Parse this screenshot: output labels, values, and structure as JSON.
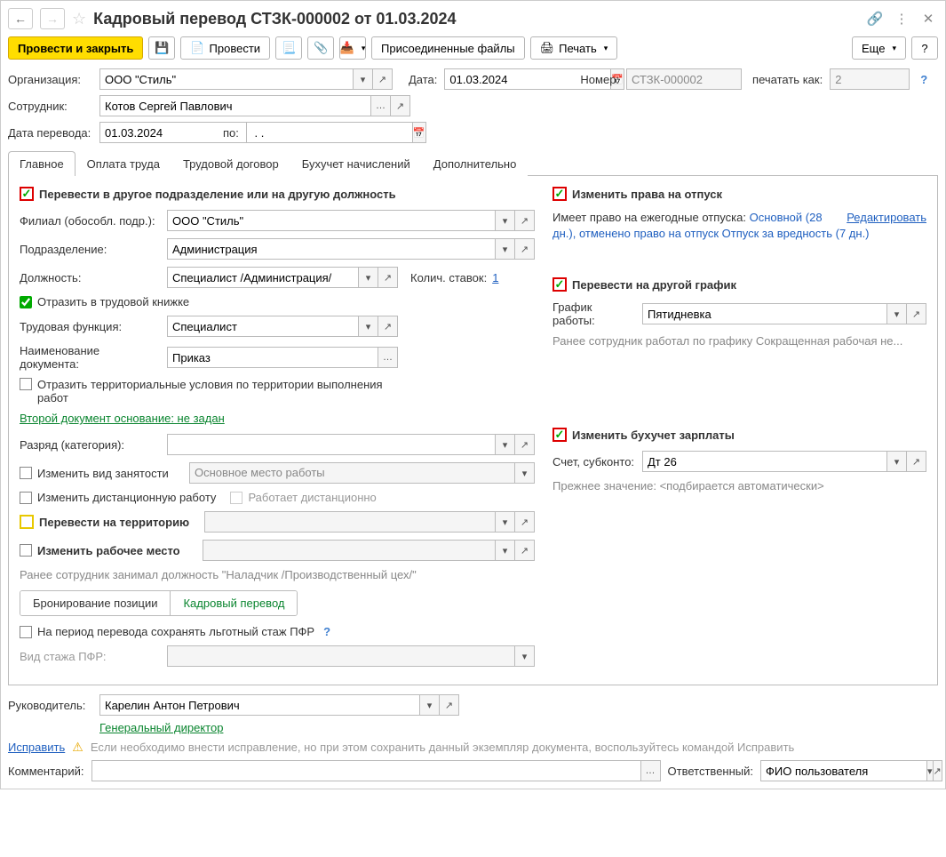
{
  "title": "Кадровый перевод СТЗК-000002 от 01.03.2024",
  "toolbar": {
    "post_close": "Провести и закрыть",
    "post": "Провести",
    "attached": "Присоединенные файлы",
    "print": "Печать",
    "more": "Еще"
  },
  "header": {
    "org_label": "Организация:",
    "org_value": "ООО \"Стиль\"",
    "date_label": "Дата:",
    "date_value": "01.03.2024",
    "number_label": "Номер:",
    "number_value": "СТЗК-000002",
    "print_as_label": "печатать как:",
    "print_as_value": "2",
    "employee_label": "Сотрудник:",
    "employee_value": "Котов Сергей Павлович",
    "transfer_date_label": "Дата перевода:",
    "transfer_date_value": "01.03.2024",
    "po_label": "по:",
    "po_value": " . ."
  },
  "tabs": {
    "main": "Главное",
    "salary": "Оплата труда",
    "contract": "Трудовой договор",
    "accounting": "Бухучет начислений",
    "additional": "Дополнительно"
  },
  "main_tab": {
    "transfer_dept": "Перевести в другое подразделение или на другую должность",
    "branch_label": "Филиал (обособл. подр.):",
    "branch_value": "ООО \"Стиль\"",
    "dept_label": "Подразделение:",
    "dept_value": "Администрация",
    "position_label": "Должность:",
    "position_value": "Специалист /Администрация/",
    "rates_label": "Колич. ставок:",
    "rates_value": "1",
    "workbook": "Отразить в трудовой книжке",
    "func_label": "Трудовая функция:",
    "func_value": "Специалист",
    "docname_label": "Наименование документа:",
    "docname_value": "Приказ",
    "territorial": "Отразить территориальные условия по территории выполнения работ",
    "second_doc": "Второй документ основание: не задан",
    "grade_label": "Разряд (категория):",
    "change_emp_type": "Изменить вид занятости",
    "emp_type_value": "Основное место работы",
    "change_remote": "Изменить дистанционную работу",
    "works_remote": "Работает дистанционно",
    "transfer_territory": "Перевести на территорию",
    "change_workplace": "Изменить рабочее место",
    "prev_position": "Ранее сотрудник занимал должность \"Наладчик /Производственный цех/\"",
    "booking": "Бронирование позиции",
    "transfer": "Кадровый перевод",
    "pfr": "На период перевода сохранять льготный стаж ПФР",
    "pfr_type_label": "Вид стажа ПФР:",
    "vacation_change": "Изменить права на отпуск",
    "vacation_text1": "Имеет право на ежегодные отпуска: ",
    "vacation_text2": "Основной (28 дн.)",
    "vacation_text3": ", отменено право на отпуск Отпуск за вредность (7 дн.)",
    "edit_link": "Редактировать",
    "schedule_change": "Перевести на другой график",
    "schedule_label": "График работы:",
    "schedule_value": "Пятидневка",
    "prev_schedule": "Ранее сотрудник работал по графику Сокращенная рабочая не...",
    "acc_change": "Изменить бухучет зарплаты",
    "acc_label": "Счет, субконто:",
    "acc_value": "Дт 26",
    "prev_acc": "Прежнее значение: <подбирается автоматически>"
  },
  "footer": {
    "manager_label": "Руководитель:",
    "manager_value": "Карелин Антон Петрович",
    "manager_pos": "Генеральный директор",
    "fix": "Исправить",
    "fix_text": "Если необходимо внести исправление, но при этом сохранить данный экземпляр документа, воспользуйтесь командой Исправить",
    "comment_label": "Комментарий:",
    "resp_label": "Ответственный:",
    "resp_value": "ФИО пользователя"
  }
}
